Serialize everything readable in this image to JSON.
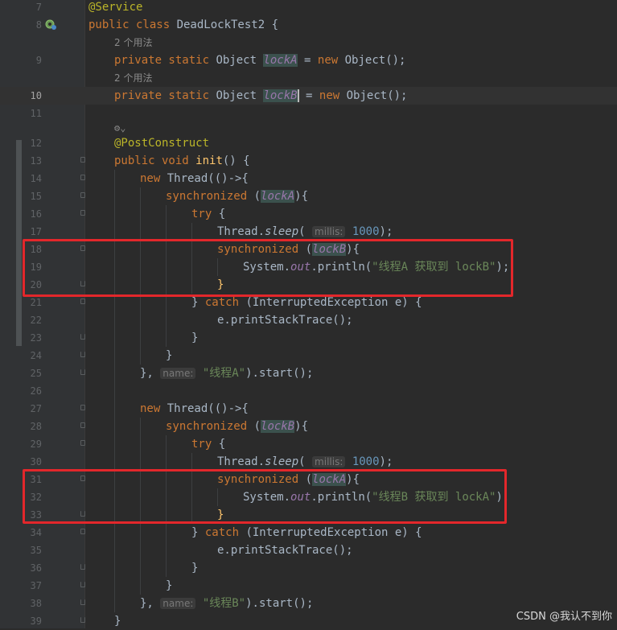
{
  "line_numbers": [
    "7",
    "8",
    "9",
    "10",
    "11",
    "12",
    "13",
    "14",
    "15",
    "16",
    "17",
    "18",
    "19",
    "20",
    "21",
    "22",
    "23",
    "24",
    "25",
    "26",
    "27",
    "28",
    "29",
    "30",
    "31",
    "32",
    "33",
    "34",
    "35",
    "36",
    "37",
    "38",
    "39"
  ],
  "code": {
    "service_annotation": "@Service",
    "class_kw": "public class ",
    "class_name": "DeadLockTest2",
    "open_brace": " {",
    "usage_hint_1": "2 个用法",
    "usage_hint_2": "2 个用法",
    "private_static": "private static ",
    "object_type": "Object ",
    "lockA": "lockA",
    "lockB": "lockB",
    "assign_eq": " = ",
    "eq_after_caret": " = ",
    "new_kw": "new ",
    "object_ctor": "Object();",
    "post_construct": "@PostConstruct",
    "public_void": "public void ",
    "init_name": "init",
    "init_tail": "() {",
    "new_thread_kw": "new ",
    "thread_open": "Thread(()->{",
    "synchronized_kw": "synchronized ",
    "paren_open": "(",
    "paren_close_brace": "){",
    "try_kw": "try",
    "try_brace": " {",
    "thread_sleep_prefix": "Thread.",
    "sleep_name": "sleep",
    "paren": "(",
    "millis_hint": "millis:",
    "sleep_value": "1000",
    "sleep_tail": ");",
    "system_prefix": "System.",
    "out_field": "out",
    "println_prefix": ".println(",
    "print_A": "\"线程A 获取到 lockB\"",
    "print_B": "\"线程B 获取到 lockA\"",
    "close_paren_semicolon": ");",
    "close_brace": "}",
    "catch_prefix": "} ",
    "catch_kw": "catch",
    "catch_tail": " (InterruptedException e) {",
    "print_stack_trace": "e.printStackTrace();",
    "thread_end_prefix": "},",
    "name_hint": "name:",
    "thread_name_A": "\"线程A\"",
    "thread_name_B": "\"线程B\"",
    "start_tail": ").start();",
    "gear_hint": "⚙⌄"
  },
  "icons": {
    "bean_gutter": "spring-bean-icon"
  },
  "highlight_color": "#e3272b",
  "watermark": "CSDN @我认不到你"
}
